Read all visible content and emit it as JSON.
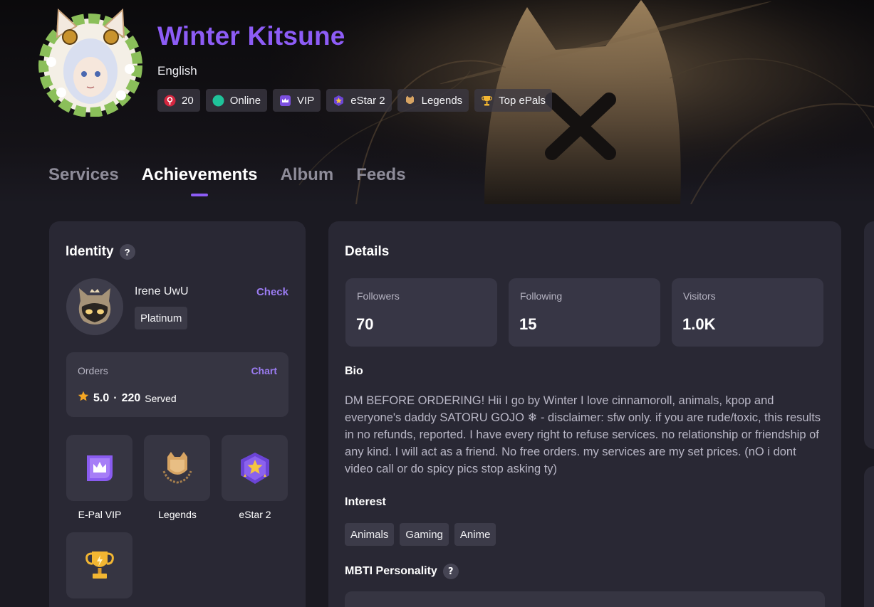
{
  "profile": {
    "name": "Winter Kitsune",
    "language": "English",
    "badges": [
      {
        "icon": "location-pin-icon",
        "label": "20"
      },
      {
        "icon": "online-dot-icon",
        "label": "Online"
      },
      {
        "icon": "vip-crown-icon",
        "label": "VIP"
      },
      {
        "icon": "estar-icon",
        "label": "eStar 2"
      },
      {
        "icon": "legends-icon",
        "label": "Legends"
      },
      {
        "icon": "trophy-icon",
        "label": "Top ePals"
      }
    ]
  },
  "tabs": [
    {
      "label": "Services",
      "active": false
    },
    {
      "label": "Achievements",
      "active": true
    },
    {
      "label": "Album",
      "active": false
    },
    {
      "label": "Feeds",
      "active": false
    }
  ],
  "identity": {
    "title": "Identity",
    "help": "?",
    "user_name": "Irene UwU",
    "check_label": "Check",
    "rank": "Platinum",
    "orders_label": "Orders",
    "chart_label": "Chart",
    "rating": "5.0",
    "separator": "·",
    "served_count": "220",
    "served_label": "Served",
    "achievements": [
      {
        "icon": "epal-vip-icon",
        "label": "E-Pal VIP"
      },
      {
        "icon": "legends-icon",
        "label": "Legends"
      },
      {
        "icon": "estar-icon",
        "label": "eStar 2"
      },
      {
        "icon": "trophy-icon",
        "label": ""
      }
    ]
  },
  "details": {
    "title": "Details",
    "stats": [
      {
        "label": "Followers",
        "value": "70"
      },
      {
        "label": "Following",
        "value": "15"
      },
      {
        "label": "Visitors",
        "value": "1.0K"
      }
    ],
    "bio_title": "Bio",
    "bio": "DM BEFORE ORDERING! Hii I go by Winter I love cinnamoroll, animals, kpop and everyone's daddy SATORU GOJO ❄ - disclaimer: sfw only. if you are rude/toxic, this results in no refunds, reported. I have every right to refuse services. no relationship or friendship of any kind. I will act as a friend. No free orders. my services are my set prices. (nO i dont video call or do spicy pics stop asking ty)",
    "interest_title": "Interest",
    "interests": [
      "Animals",
      "Gaming",
      "Anime"
    ],
    "mbti_title": "MBTI Personality",
    "mbti_help": "?"
  },
  "colors": {
    "accent": "#8d5cf6",
    "link": "#9b7cf2",
    "background": "#1b1a22",
    "card": "#292834",
    "online": "#1fc39a",
    "star": "#f5a623"
  }
}
